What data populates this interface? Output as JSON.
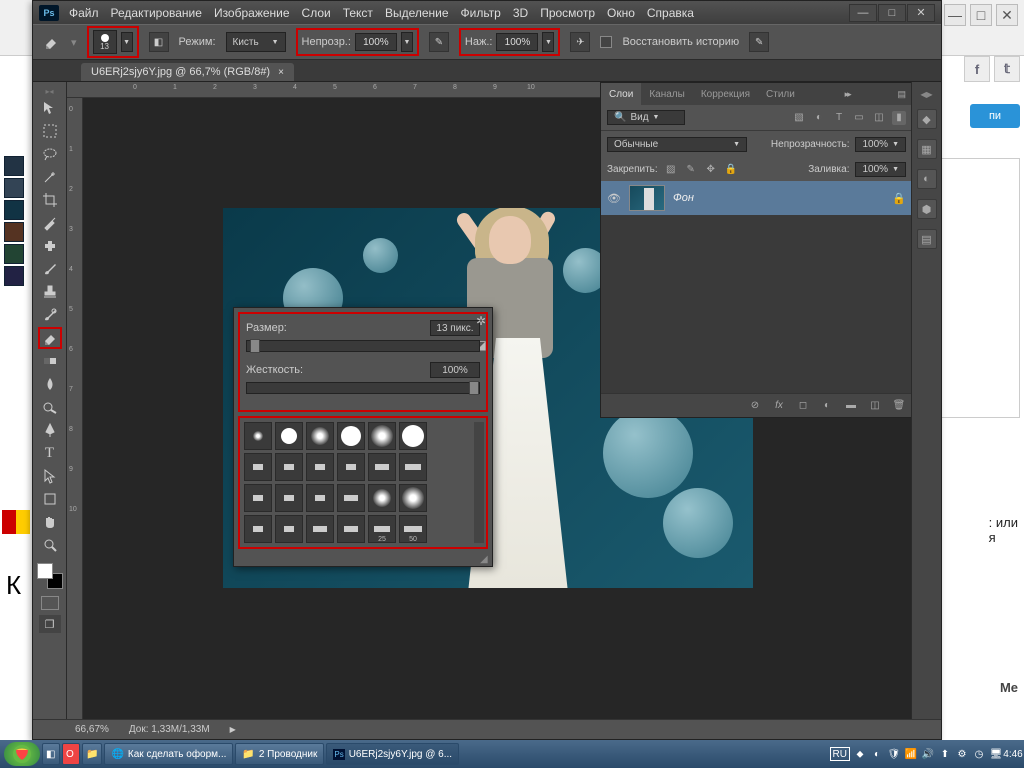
{
  "menu": {
    "file": "Файл",
    "edit": "Редактирование",
    "image": "Изображение",
    "layer": "Слои",
    "type": "Текст",
    "select": "Выделение",
    "filter": "Фильтр",
    "threeD": "3D",
    "view": "Просмотр",
    "window": "Окно",
    "help": "Справка"
  },
  "options": {
    "brush_size": "13",
    "mode_label": "Режим:",
    "mode_value": "Кисть",
    "opacity_label": "Непрозр.:",
    "opacity_value": "100%",
    "flow_label": "Наж.:",
    "flow_value": "100%",
    "restore_history": "Восстановить историю"
  },
  "doc": {
    "title": "U6ERj2sjy6Y.jpg @ 66,7% (RGB/8#)"
  },
  "popup": {
    "size_label": "Размер:",
    "size_value": "13 пикс.",
    "hardness_label": "Жесткость:",
    "hardness_value": "100%",
    "preset_25": "25",
    "preset_50": "50"
  },
  "layers_panel": {
    "tab_layers": "Слои",
    "tab_channels": "Каналы",
    "tab_corrections": "Коррекция",
    "tab_styles": "Стили",
    "filter_kind": "Вид",
    "blend_mode": "Обычные",
    "opacity_label": "Непрозрачность:",
    "opacity_value": "100%",
    "lock_label": "Закрепить:",
    "fill_label": "Заливка:",
    "fill_value": "100%",
    "layer_name": "Фон"
  },
  "status": {
    "zoom": "66,67%",
    "doc_size": "Док: 1,33M/1,33M"
  },
  "taskbar": {
    "b1": "Как сделать оформ...",
    "b2": "2 Проводник",
    "b3": "U6ERj2sjy6Y.jpg @ 6...",
    "lang": "RU",
    "time": "4:46"
  },
  "behind": {
    "btn": "пи",
    "txt1": ": или",
    "txt2": "я",
    "me": "Me",
    "k": "К"
  }
}
